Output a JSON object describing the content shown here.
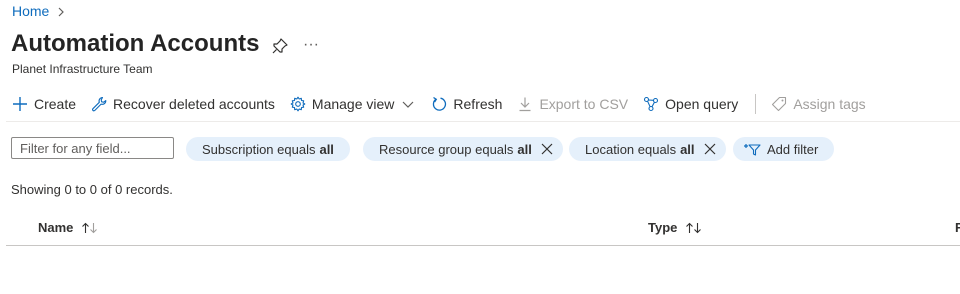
{
  "breadcrumb": {
    "home": "Home"
  },
  "header": {
    "title": "Automation Accounts",
    "more": "···",
    "subtitle": "Planet Infrastructure Team"
  },
  "toolbar": {
    "create": "Create",
    "recover": "Recover deleted accounts",
    "manage_view": "Manage view",
    "refresh": "Refresh",
    "export": "Export to CSV",
    "open_query": "Open query",
    "assign_tags": "Assign tags"
  },
  "filters": {
    "placeholder": "Filter for any field...",
    "subscription": {
      "label": "Subscription equals",
      "value": "all"
    },
    "resource_group": {
      "label": "Resource group equals",
      "value": "all"
    },
    "location": {
      "label": "Location equals",
      "value": "all"
    },
    "add_filter": "Add filter"
  },
  "records_text": "Showing 0 to 0 of 0 records.",
  "table": {
    "columns": [
      "Name",
      "Type",
      "F"
    ]
  },
  "colors": {
    "accent": "#0f6cbd",
    "pill_bg": "#e5f0fb",
    "disabled": "#a19f9d"
  },
  "icons": [
    "chevron-right-icon",
    "pin-icon",
    "ellipsis-icon",
    "plus-icon",
    "wrench-icon",
    "gear-icon",
    "chevron-down-icon",
    "refresh-icon",
    "download-icon",
    "query-icon",
    "tag-icon",
    "close-icon",
    "add-filter-icon",
    "sort-icon"
  ]
}
